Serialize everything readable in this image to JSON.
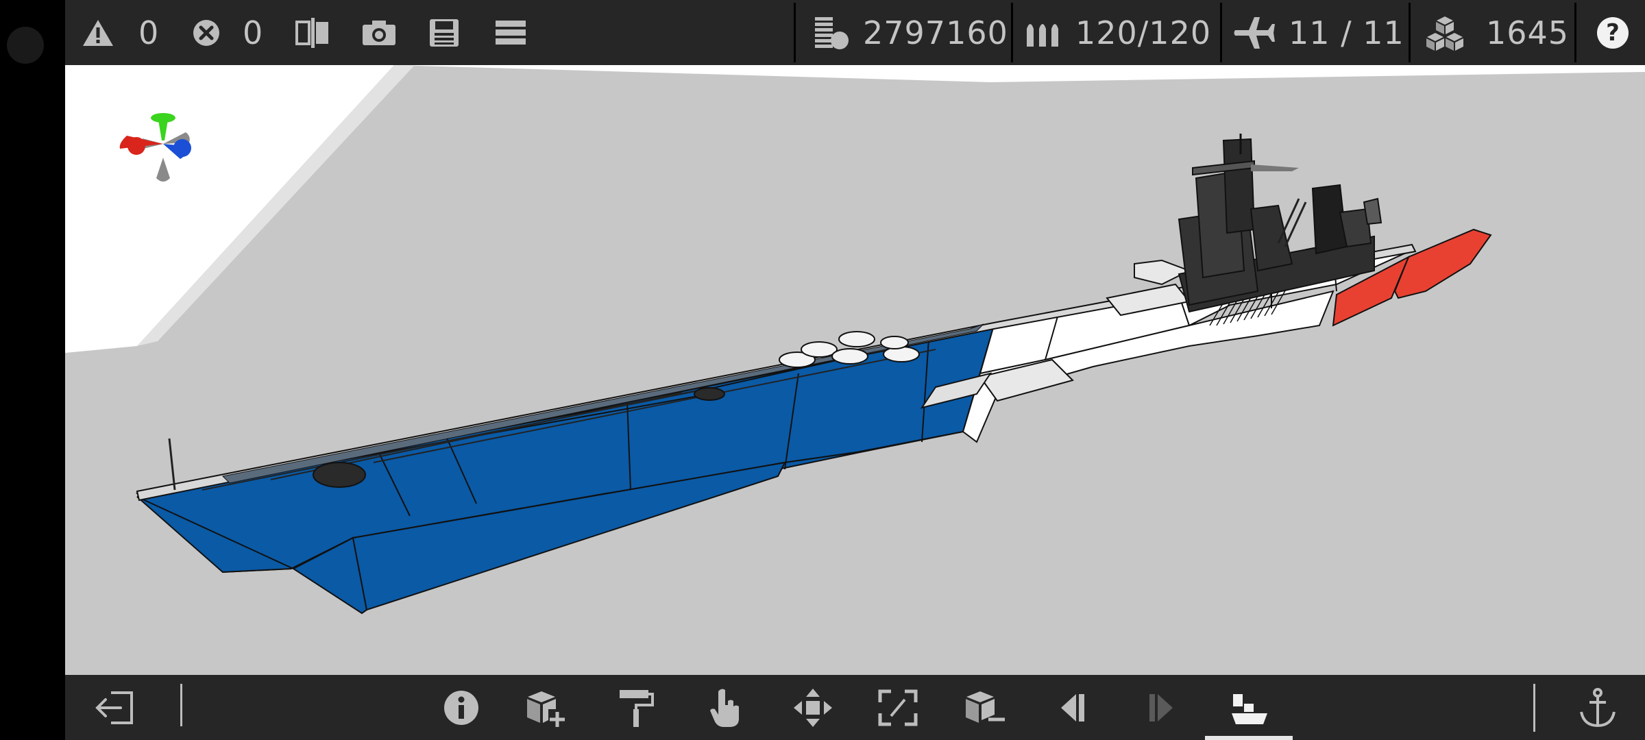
{
  "toolbar": {
    "warnings": "0",
    "errors": "0",
    "cost": "2797160",
    "ammo": "120/120",
    "aircraft": "11 / 11",
    "parts": "1645",
    "help": "?"
  },
  "icons": {
    "warning": "warning-icon",
    "error": "error-icon",
    "mirror": "mirror-icon",
    "camera": "camera-icon",
    "save": "save-icon",
    "menu": "menu-icon",
    "cost": "cost-icon",
    "ammo": "ammo-icon",
    "aircraft": "aircraft-icon",
    "parts": "parts-icon"
  },
  "bottom_tools": [
    "exit",
    "info",
    "add-block",
    "paint",
    "select",
    "move",
    "resize",
    "remove-block",
    "undo",
    "redo",
    "blueprint",
    "anchor"
  ],
  "colors": {
    "hull_blue": "#0a5aa6",
    "hull_white": "#ffffff",
    "hull_red": "#e84132",
    "superstructure": "#333333",
    "background": "#c7c7c7",
    "toolbar": "#262626",
    "axis_x": "#d9251c",
    "axis_y": "#3bd41e",
    "axis_z": "#1b4fd6"
  }
}
